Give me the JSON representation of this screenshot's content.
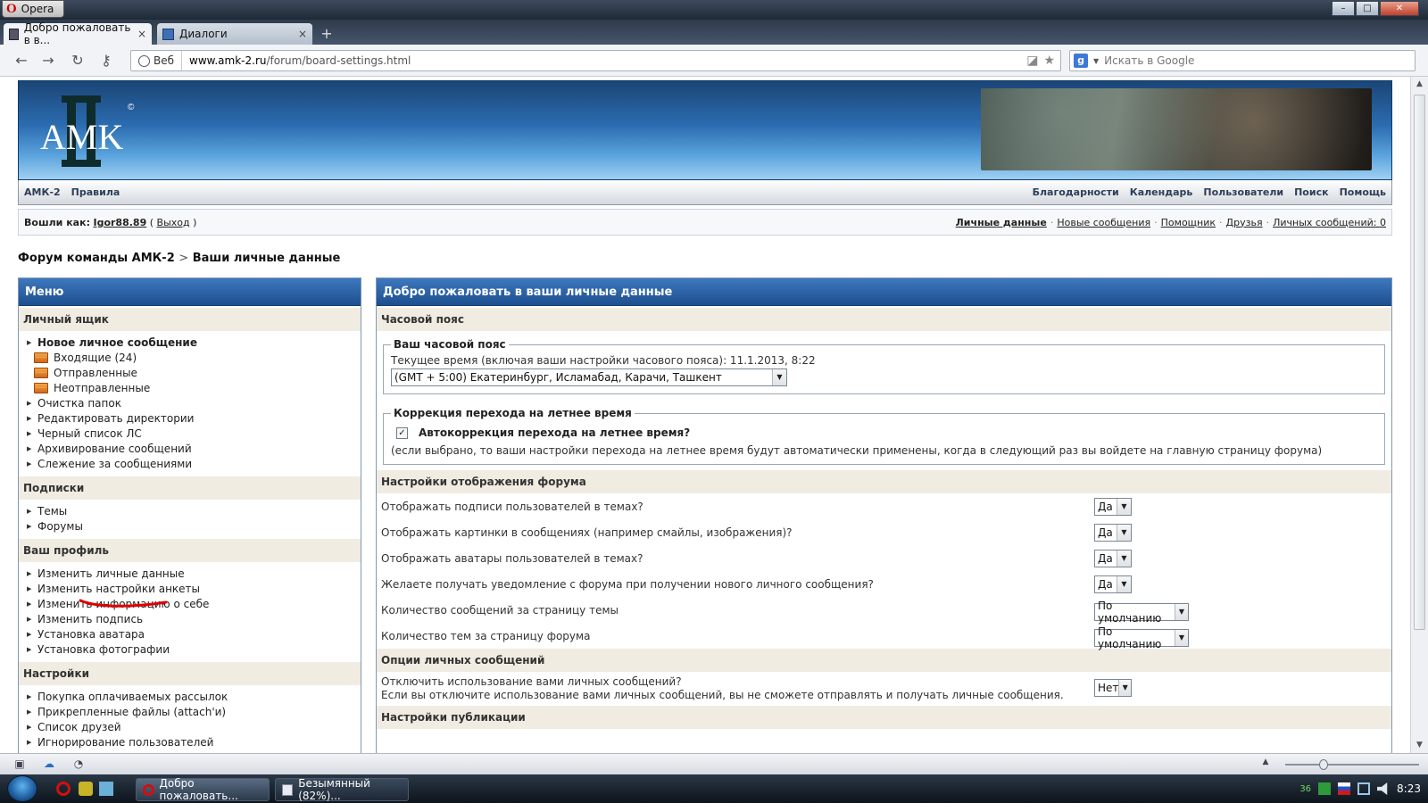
{
  "window": {
    "app_menu_label": "Opera",
    "minimize": "–",
    "maximize": "□",
    "close": "✕"
  },
  "tabs": [
    {
      "title": "Добро пожаловать в в...",
      "close": "×"
    },
    {
      "title": "Диалоги",
      "close": "×"
    }
  ],
  "toolbar": {
    "web_label": "Веб",
    "url_host": "www.amk-2.ru",
    "url_path": "/forum/board-settings.html",
    "search_placeholder": "Искать в Google"
  },
  "banner": {
    "logo_text": "AMK",
    "logo_mark": "II",
    "copyright": "©"
  },
  "navbar": {
    "left": [
      "АМК-2",
      "Правила"
    ],
    "right": [
      "Благодарности",
      "Календарь",
      "Пользователи",
      "Поиск",
      "Помощь"
    ]
  },
  "userbar": {
    "logged_in_label": "Вошли как:",
    "username": "Igor88.89",
    "paren_open": "(",
    "logout": "Выход",
    "paren_close": ")",
    "links": [
      "Личные данные",
      "Новые сообщения",
      "Помощник",
      "Друзья",
      "Личных сообщений: 0"
    ],
    "separator": "·"
  },
  "breadcrumb": {
    "root": "Форум команды АМК-2",
    "sep": ">",
    "current": "Ваши личные данные"
  },
  "menu": {
    "title": "Меню",
    "sections": [
      {
        "title": "Личный ящик",
        "items": [
          {
            "label": "Новое личное сообщение",
            "kind": "strong"
          },
          {
            "label": "Входящие (24)",
            "kind": "folder"
          },
          {
            "label": "Отправленные",
            "kind": "folder"
          },
          {
            "label": "Неотправленные",
            "kind": "folder"
          },
          {
            "label": "Очистка папок",
            "kind": "item"
          },
          {
            "label": "Редактировать директории",
            "kind": "item"
          },
          {
            "label": "Черный список ЛС",
            "kind": "item"
          },
          {
            "label": "Архивирование сообщений",
            "kind": "item"
          },
          {
            "label": "Слежение за сообщениями",
            "kind": "item"
          }
        ]
      },
      {
        "title": "Подписки",
        "items": [
          {
            "label": "Темы",
            "kind": "item"
          },
          {
            "label": "Форумы",
            "kind": "item"
          }
        ]
      },
      {
        "title": "Ваш профиль",
        "items": [
          {
            "label": "Изменить личные данные",
            "kind": "item"
          },
          {
            "label": "Изменить настройки анкеты",
            "kind": "item"
          },
          {
            "label": "Изменить информацию о себе",
            "kind": "item"
          },
          {
            "label": "Изменить подпись",
            "kind": "item"
          },
          {
            "label": "Установка аватара",
            "kind": "item"
          },
          {
            "label": "Установка фотографии",
            "kind": "item"
          }
        ]
      },
      {
        "title": "Настройки",
        "items": [
          {
            "label": "Покупка оплачиваемых рассылок",
            "kind": "item"
          },
          {
            "label": "Прикрепленные файлы (attach'и)",
            "kind": "item"
          },
          {
            "label": "Список друзей",
            "kind": "item"
          },
          {
            "label": "Игнорирование пользователей",
            "kind": "item"
          }
        ]
      }
    ]
  },
  "main": {
    "title": "Добро пожаловать в ваши личные данные",
    "timezone": {
      "section": "Часовой пояс",
      "legend": "Ваш часовой пояс",
      "current_time": "Текущее время (включая ваши настройки часового пояса): 11.1.2013, 8:22",
      "selected": "(GMT + 5:00) Екатеринбург, Исламабад, Карачи, Ташкент"
    },
    "dst": {
      "legend": "Коррекция перехода на летнее время",
      "checkbox_label": "Автокоррекция перехода на летнее время?",
      "checked": true,
      "note": "(если выбрано, то ваши настройки перехода на летнее время будут автоматически применены, когда в следующий раз вы войдете на главную страницу форума)"
    },
    "display": {
      "section": "Настройки отображения форума",
      "rows": [
        {
          "label": "Отображать подписи пользователей в темах?",
          "value": "Да",
          "width": "short"
        },
        {
          "label": "Отображать картинки в сообщениях (например смайлы, изображения)?",
          "value": "Да",
          "width": "short"
        },
        {
          "label": "Отображать аватары пользователей в темах?",
          "value": "Да",
          "width": "short"
        },
        {
          "label": "Желаете получать уведомление с форума при получении нового личного сообщения?",
          "value": "Да",
          "width": "short"
        },
        {
          "label": "Количество сообщений за страницу темы",
          "value": "По умолчанию",
          "width": "long"
        },
        {
          "label": "Количество тем за страницу форума",
          "value": "По умолчанию",
          "width": "long"
        }
      ]
    },
    "pm": {
      "section": "Опции личных сообщений",
      "label": "Отключить использование вами личных сообщений?",
      "note": "Если вы отключите использование вами личных сообщений, вы не сможете отправлять и получать личные сообщения.",
      "value": "Нет"
    },
    "publish": {
      "section": "Настройки публикации"
    }
  },
  "taskbar": {
    "tasks": [
      "Добро пожаловать...",
      "Безымянный (82%)..."
    ],
    "tray_temp": "36",
    "clock": "8:23"
  },
  "colors": {
    "panel_header": "#2a5fa3",
    "section_bg": "#f1ece2",
    "annotation_red": "#e00000"
  }
}
